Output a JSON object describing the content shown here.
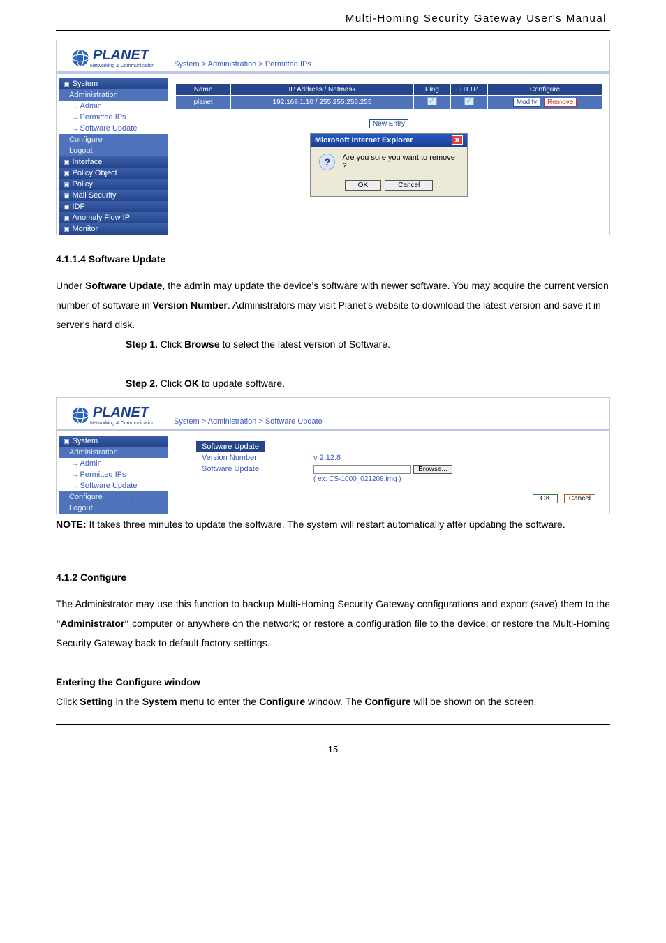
{
  "header": {
    "title": "Multi-Homing  Security  Gateway  User's  Manual"
  },
  "logo": {
    "brand": "PLANET",
    "sub": "Networking & Communication"
  },
  "breadcrumb1": "System > Administration > Permitted IPs",
  "sidebar1": {
    "system": "System",
    "administration": "Administration",
    "admin": "Admin",
    "permitted": "Permitted IPs",
    "swupdate": "Software Update",
    "configure": "Configure",
    "logout": "Logout",
    "interface": "Interface",
    "policyobj": "Policy Object",
    "policy": "Policy",
    "mailsec": "Mail Security",
    "idp": "IDP",
    "anomaly": "Anomaly Flow IP",
    "monitor": "Monitor"
  },
  "table1": {
    "h_name": "Name",
    "h_ip": "IP Address / Netmask",
    "h_ping": "Ping",
    "h_http": "HTTP",
    "h_conf": "Configure",
    "r_name": "planet",
    "r_ip": "192.168.1.10 / 255.255.255.255",
    "modify": "Modify",
    "remove": "Remove",
    "newentry": "New  Entry"
  },
  "dialog": {
    "title": "Microsoft Internet Explorer",
    "msg": "Are you sure you want to remove ?",
    "ok": "OK",
    "cancel": "Cancel"
  },
  "swtext": {
    "heading": "4.1.1.4 Software Update",
    "p1a": "Under ",
    "p1b": "Software Update",
    "p1c": ", the admin may update the device's software with newer software. You may acquire the current version number of software in ",
    "p1d": "Version Number",
    "p1e": ". Administrators may visit Planet's website to download the latest version and save it in server's hard disk.",
    "step1a": "Step 1.",
    "step1b": "  Click ",
    "step1c": "Browse",
    "step1d": " to select the latest version of Software.",
    "step2a": "Step 2.",
    "step2b": "  Click ",
    "step2c": "OK",
    "step2d": " to update software."
  },
  "breadcrumb2": "System > Administration > Software Update",
  "swpanel": {
    "title": "Software Update",
    "vn_label": "Version Number :",
    "vn_val": "v 2.12.8",
    "su_label": "Software Update :",
    "browse": "Browse...",
    "ex": "( ex: CS-1000_021208.img )",
    "ok": "OK",
    "cancel": "Cancel"
  },
  "note": {
    "label": "NOTE:",
    "text": " It takes three minutes to update the software. The system will restart automatically after updating the software."
  },
  "cfg": {
    "heading": "4.1.2 Configure",
    "p1a": "The Administrator may use this function to backup Multi-Homing Security Gateway configurations and export (save) them to the ",
    "p1b": "\"Administrator\"",
    "p1c": " computer or anywhere on the network; or restore a configuration file to the device; or restore the Multi-Homing Security Gateway back to default factory settings.",
    "entry": "Entering the Configure window",
    "p2a": "Click ",
    "p2b": "Setting",
    "p2c": " in the ",
    "p2d": "System",
    "p2e": " menu to enter the ",
    "p2f": "Configure",
    "p2g": " window. The ",
    "p2h": "Configure",
    "p2i": " will be shown on the screen."
  },
  "footer": {
    "page": "- 15 -"
  }
}
